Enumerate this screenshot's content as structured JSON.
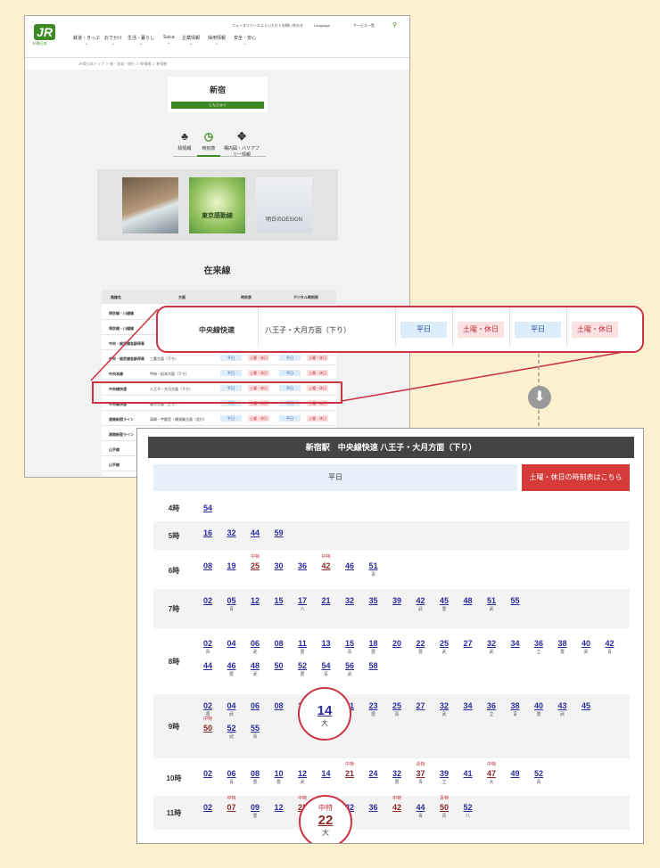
{
  "header": {
    "logo": "JR",
    "logo_sub": "JR東日本",
    "top_links": [
      "ニュースリリース",
      "よくいただくお問い合わせ",
      "Language",
      "サービス一覧"
    ],
    "nav": [
      "鉄道・きっぷ",
      "おでかけ",
      "生活・暮らし",
      "Suica",
      "企業情報",
      "採用情報",
      "安全・安心"
    ]
  },
  "breadcrumb": "JR東日本トップ ＞ 駅・鉄道・旅行 ＞ 駅情報 ＞ 新宿駅",
  "station": {
    "name": "新宿",
    "reading": "しんじゅく"
  },
  "tabs": [
    "駅情報",
    "時刻表",
    "構内図・バリアフリー情報"
  ],
  "banners": [
    "",
    "東京感動線",
    "明日のDESIGN"
  ],
  "section_title": "在来線",
  "table_headers": [
    "路線名",
    "方面",
    "時刻表",
    "デジタル時刻表"
  ],
  "table_rows": [
    {
      "line": "埼京線・川越線",
      "dir": ""
    },
    {
      "line": "埼京線・川越線",
      "dir": ""
    },
    {
      "line": "中央・総武線各駅停車",
      "dir": ""
    },
    {
      "line": "中央・総武線各駅停車",
      "dir": "三鷹方面（下り）"
    },
    {
      "line": "中央本線",
      "dir": "甲府・松本方面（下り）"
    },
    {
      "line": "中央線快速",
      "dir": "八王子・大月方面（下り）"
    },
    {
      "line": "中央線快速",
      "dir": "東京方面（上り）"
    },
    {
      "line": "湘南新宿ライン",
      "dir": "高崎・宇都宮・横須賀方面（北行）"
    },
    {
      "line": "湘南新宿ライン",
      "dir": "大船・逗子方面（南行）"
    },
    {
      "line": "山手線",
      "dir": ""
    },
    {
      "line": "山手線",
      "dir": ""
    }
  ],
  "btn_weekday": "平日",
  "btn_holiday": "土曜・休日",
  "zoom": {
    "line": "中央線快速",
    "dir": "八王子・大月方面（下り）",
    "b1": "平日",
    "b2": "土曜・休日",
    "b3": "平日",
    "b4": "土曜・休日"
  },
  "timetable": {
    "title": "新宿駅　中央線快速 八王子・大月方面（下り）",
    "tab_weekday": "平日",
    "tab_holiday": "土曜・休日の時刻表はこちら"
  },
  "hours": [
    {
      "h": "4時",
      "rows": [
        [
          [
            "54",
            "",
            ""
          ]
        ]
      ]
    },
    {
      "h": "5時",
      "rows": [
        [
          [
            "16",
            "",
            ""
          ],
          [
            "32",
            "",
            ""
          ],
          [
            "44",
            "",
            ""
          ],
          [
            "59",
            "",
            ""
          ]
        ]
      ]
    },
    {
      "h": "6時",
      "rows": [
        [
          [
            "08",
            "",
            ""
          ],
          [
            "19",
            "",
            ""
          ],
          [
            "25",
            "中特",
            ""
          ],
          [
            "30",
            "",
            ""
          ],
          [
            "36",
            "",
            ""
          ],
          [
            "42",
            "中特",
            ""
          ],
          [
            "46",
            "",
            ""
          ],
          [
            "51",
            "",
            "青"
          ]
        ]
      ]
    },
    {
      "h": "7時",
      "rows": [
        [
          [
            "02",
            "",
            ""
          ],
          [
            "05",
            "",
            "青"
          ],
          [
            "12",
            "",
            ""
          ],
          [
            "15",
            "",
            ""
          ],
          [
            "17",
            "",
            "八"
          ],
          [
            "21",
            "",
            ""
          ],
          [
            "32",
            "",
            ""
          ],
          [
            "35",
            "",
            ""
          ],
          [
            "39",
            "",
            ""
          ],
          [
            "42",
            "",
            "武"
          ],
          [
            "45",
            "",
            "豊"
          ],
          [
            "48",
            "",
            ""
          ],
          [
            "51",
            "",
            "武"
          ],
          [
            "55",
            "",
            ""
          ]
        ]
      ]
    },
    {
      "h": "8時",
      "rows": [
        [
          [
            "02",
            "",
            "青"
          ],
          [
            "04",
            "",
            ""
          ],
          [
            "06",
            "",
            "武"
          ],
          [
            "08",
            "",
            ""
          ],
          [
            "11",
            "",
            "豊"
          ],
          [
            "13",
            "",
            ""
          ],
          [
            "15",
            "",
            "青"
          ],
          [
            "18",
            "",
            "豊"
          ],
          [
            "20",
            "",
            ""
          ],
          [
            "22",
            "",
            "豊"
          ],
          [
            "25",
            "",
            "武"
          ],
          [
            "27",
            "",
            ""
          ],
          [
            "32",
            "",
            "武"
          ],
          [
            "34",
            "",
            ""
          ],
          [
            "36",
            "",
            "立"
          ],
          [
            "38",
            "",
            "豊"
          ],
          [
            "40",
            "",
            "武"
          ],
          [
            "42",
            "",
            "青"
          ]
        ],
        [
          [
            "44",
            "",
            ""
          ],
          [
            "46",
            "",
            "豊"
          ],
          [
            "48",
            "",
            "武"
          ],
          [
            "50",
            "",
            ""
          ],
          [
            "52",
            "",
            "豊"
          ],
          [
            "54",
            "",
            "青"
          ],
          [
            "56",
            "",
            "武"
          ],
          [
            "58",
            "",
            ""
          ]
        ]
      ]
    },
    {
      "h": "9時",
      "rows": [
        [
          [
            "02",
            "",
            "豊"
          ],
          [
            "04",
            "",
            "武"
          ],
          [
            "06",
            "",
            ""
          ],
          [
            "08",
            "",
            ""
          ],
          [
            "14",
            "",
            "大"
          ],
          [
            "18",
            "",
            ""
          ],
          [
            "21",
            "",
            ""
          ],
          [
            "23",
            "",
            "豊"
          ],
          [
            "25",
            "",
            "青"
          ],
          [
            "27",
            "",
            ""
          ],
          [
            "32",
            "",
            "武"
          ],
          [
            "34",
            "",
            ""
          ],
          [
            "36",
            "",
            "立"
          ],
          [
            "38",
            "",
            "青"
          ],
          [
            "40",
            "",
            "豊"
          ],
          [
            "43",
            "",
            "武"
          ],
          [
            "45",
            "",
            ""
          ]
        ],
        [
          [
            "50",
            "中特",
            ""
          ],
          [
            "52",
            "",
            "武"
          ],
          [
            "55",
            "",
            "青"
          ]
        ]
      ]
    },
    {
      "h": "10時",
      "rows": [
        [
          [
            "02",
            "",
            ""
          ],
          [
            "06",
            "",
            "青"
          ],
          [
            "08",
            "",
            "豊"
          ],
          [
            "10",
            "",
            "豊"
          ],
          [
            "12",
            "",
            "武"
          ],
          [
            "14",
            "",
            ""
          ],
          [
            "21",
            "中特",
            ""
          ],
          [
            "24",
            "",
            ""
          ],
          [
            "32",
            "",
            "豊"
          ],
          [
            "37",
            "青特",
            "青"
          ],
          [
            "39",
            "",
            "立"
          ],
          [
            "41",
            "",
            ""
          ],
          [
            "47",
            "中特",
            "大"
          ],
          [
            "49",
            "",
            ""
          ],
          [
            "52",
            "",
            "青"
          ]
        ]
      ]
    },
    {
      "h": "11時",
      "rows": [
        [
          [
            "02",
            "",
            ""
          ],
          [
            "07",
            "中特",
            ""
          ],
          [
            "09",
            "",
            "豊"
          ],
          [
            "12",
            "",
            ""
          ],
          [
            "22",
            "中特",
            "大"
          ],
          [
            "24",
            "",
            ""
          ],
          [
            "32",
            "",
            ""
          ],
          [
            "36",
            "",
            ""
          ],
          [
            "42",
            "中特",
            ""
          ],
          [
            "44",
            "",
            "青"
          ],
          [
            "50",
            "青特",
            "青"
          ],
          [
            "52",
            "",
            "八"
          ]
        ]
      ]
    }
  ],
  "circles": [
    {
      "min": "14",
      "dest": "大",
      "tag": ""
    },
    {
      "min": "22",
      "dest": "大",
      "tag": "中特"
    }
  ]
}
